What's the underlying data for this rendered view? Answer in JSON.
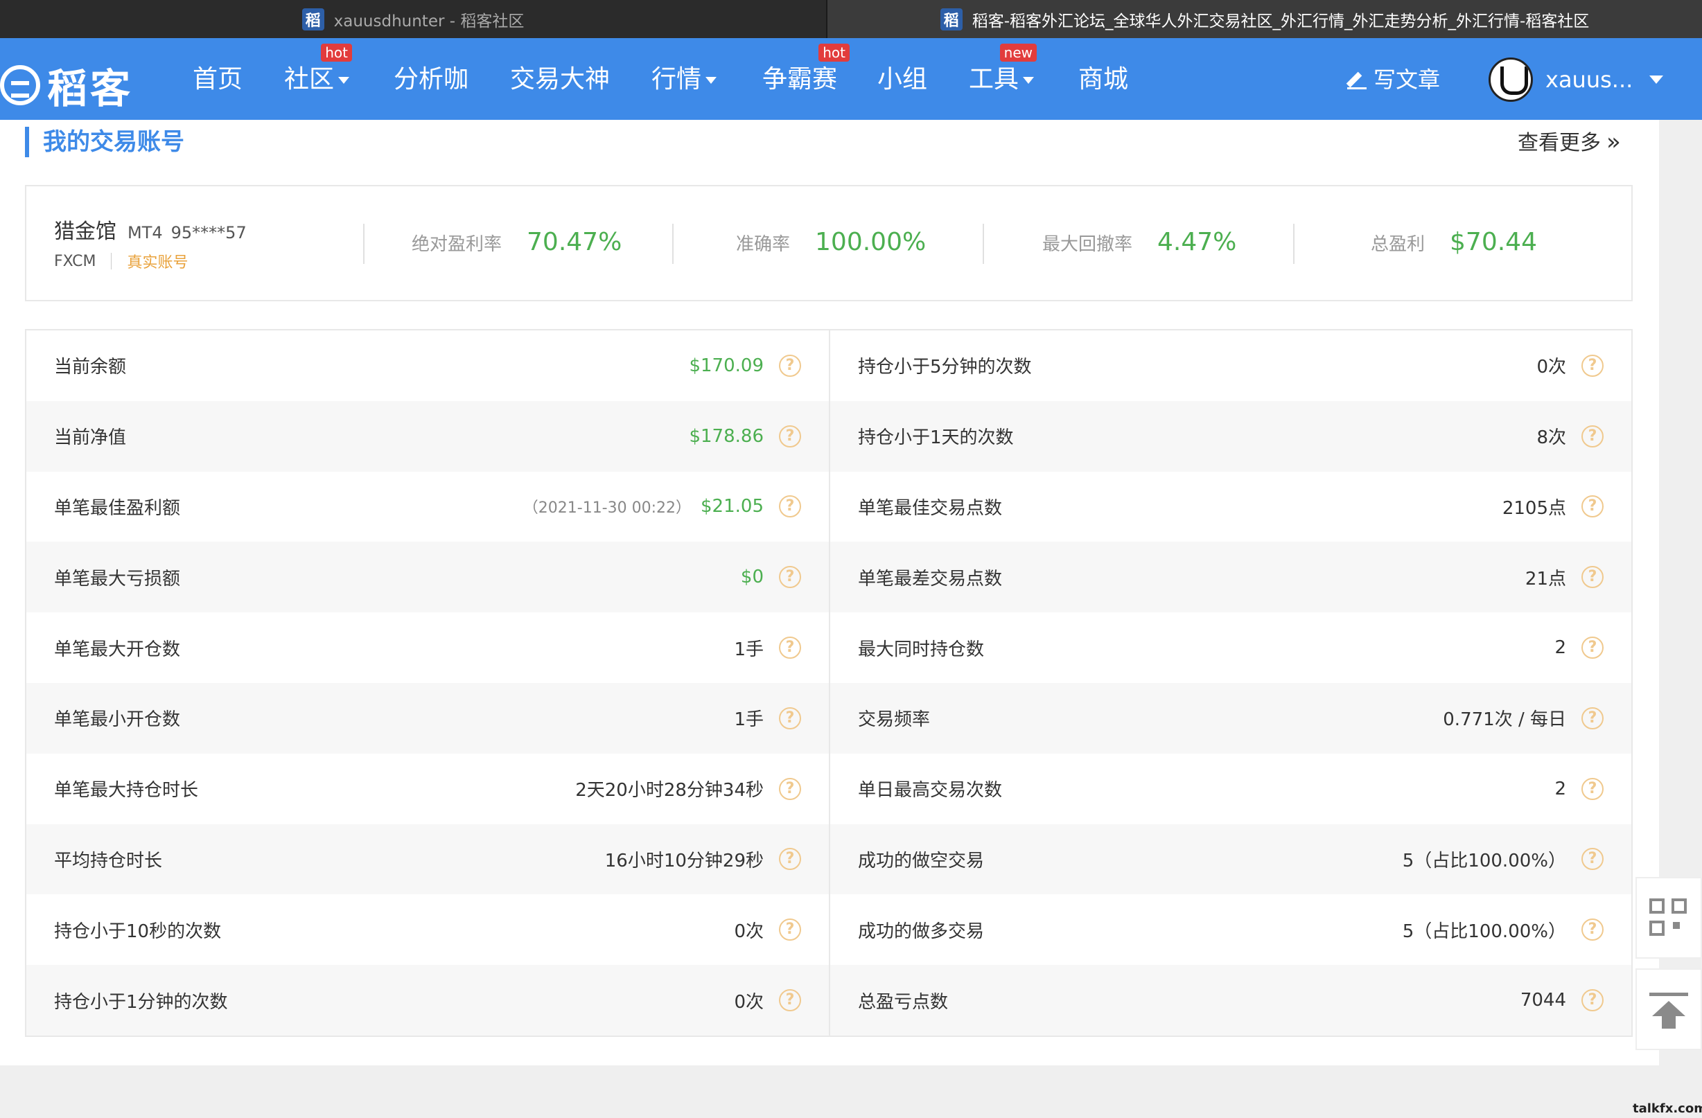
{
  "browser": {
    "tabs": [
      {
        "favicon": "稻",
        "title": "xauusdhunter - 稻客社区"
      },
      {
        "favicon": "稻",
        "title": "稻客-稻客外汇论坛_全球华人外汇交易社区_外汇行情_外汇走势分析_外汇行情-稻客社区"
      }
    ]
  },
  "header": {
    "logo_text": "稻客",
    "nav": [
      {
        "label": "首页",
        "badge": "",
        "dropdown": false
      },
      {
        "label": "社区",
        "badge": "hot",
        "dropdown": true
      },
      {
        "label": "分析咖",
        "badge": "",
        "dropdown": false
      },
      {
        "label": "交易大神",
        "badge": "",
        "dropdown": false
      },
      {
        "label": "行情",
        "badge": "",
        "dropdown": true
      },
      {
        "label": "争霸赛",
        "badge": "hot",
        "dropdown": false
      },
      {
        "label": "小组",
        "badge": "",
        "dropdown": false
      },
      {
        "label": "工具",
        "badge": "new",
        "dropdown": true
      },
      {
        "label": "商城",
        "badge": "",
        "dropdown": false
      }
    ],
    "write_label": "写文章",
    "username": "xauus..."
  },
  "section": {
    "title": "我的交易账号",
    "more_label": "查看更多",
    "more_icon": "»"
  },
  "account": {
    "name": "猎金馆",
    "platform": "MT4",
    "number": "95****57",
    "broker": "FXCM",
    "type": "真实账号",
    "stats": [
      {
        "label": "绝对盈利率",
        "value": "70.47%"
      },
      {
        "label": "准确率",
        "value": "100.00%"
      },
      {
        "label": "最大回撤率",
        "value": "4.47%"
      },
      {
        "label": "总盈利",
        "value": "$70.44"
      }
    ]
  },
  "details": {
    "left": [
      {
        "label": "当前余额",
        "note": "",
        "value": "$170.09",
        "green": true
      },
      {
        "label": "当前净值",
        "note": "",
        "value": "$178.86",
        "green": true
      },
      {
        "label": "单笔最佳盈利额",
        "note": "（2021-11-30 00:22）",
        "value": "$21.05",
        "green": true
      },
      {
        "label": "单笔最大亏损额",
        "note": "",
        "value": "$0",
        "green": true
      },
      {
        "label": "单笔最大开仓数",
        "note": "",
        "value": "1手",
        "green": false
      },
      {
        "label": "单笔最小开仓数",
        "note": "",
        "value": "1手",
        "green": false
      },
      {
        "label": "单笔最大持仓时长",
        "note": "",
        "value": "2天20小时28分钟34秒",
        "green": false
      },
      {
        "label": "平均持仓时长",
        "note": "",
        "value": "16小时10分钟29秒",
        "green": false
      },
      {
        "label": "持仓小于10秒的次数",
        "note": "",
        "value": "0次",
        "green": false
      },
      {
        "label": "持仓小于1分钟的次数",
        "note": "",
        "value": "0次",
        "green": false
      }
    ],
    "right": [
      {
        "label": "持仓小于5分钟的次数",
        "note": "",
        "value": "0次",
        "green": false
      },
      {
        "label": "持仓小于1天的次数",
        "note": "",
        "value": "8次",
        "green": false
      },
      {
        "label": "单笔最佳交易点数",
        "note": "",
        "value": "2105点",
        "green": false
      },
      {
        "label": "单笔最差交易点数",
        "note": "",
        "value": "21点",
        "green": false
      },
      {
        "label": "最大同时持仓数",
        "note": "",
        "value": "2",
        "green": false
      },
      {
        "label": "交易频率",
        "note": "",
        "value": "0.771次 / 每日",
        "green": false
      },
      {
        "label": "单日最高交易次数",
        "note": "",
        "value": "2",
        "green": false
      },
      {
        "label": "成功的做空交易",
        "note": "",
        "value": "5（占比100.00%）",
        "green": false
      },
      {
        "label": "成功的做多交易",
        "note": "",
        "value": "5（占比100.00%）",
        "green": false
      },
      {
        "label": "总盈亏点数",
        "note": "",
        "value": "7044",
        "green": false
      }
    ],
    "help_glyph": "?"
  },
  "watermark": "talkfx.com"
}
